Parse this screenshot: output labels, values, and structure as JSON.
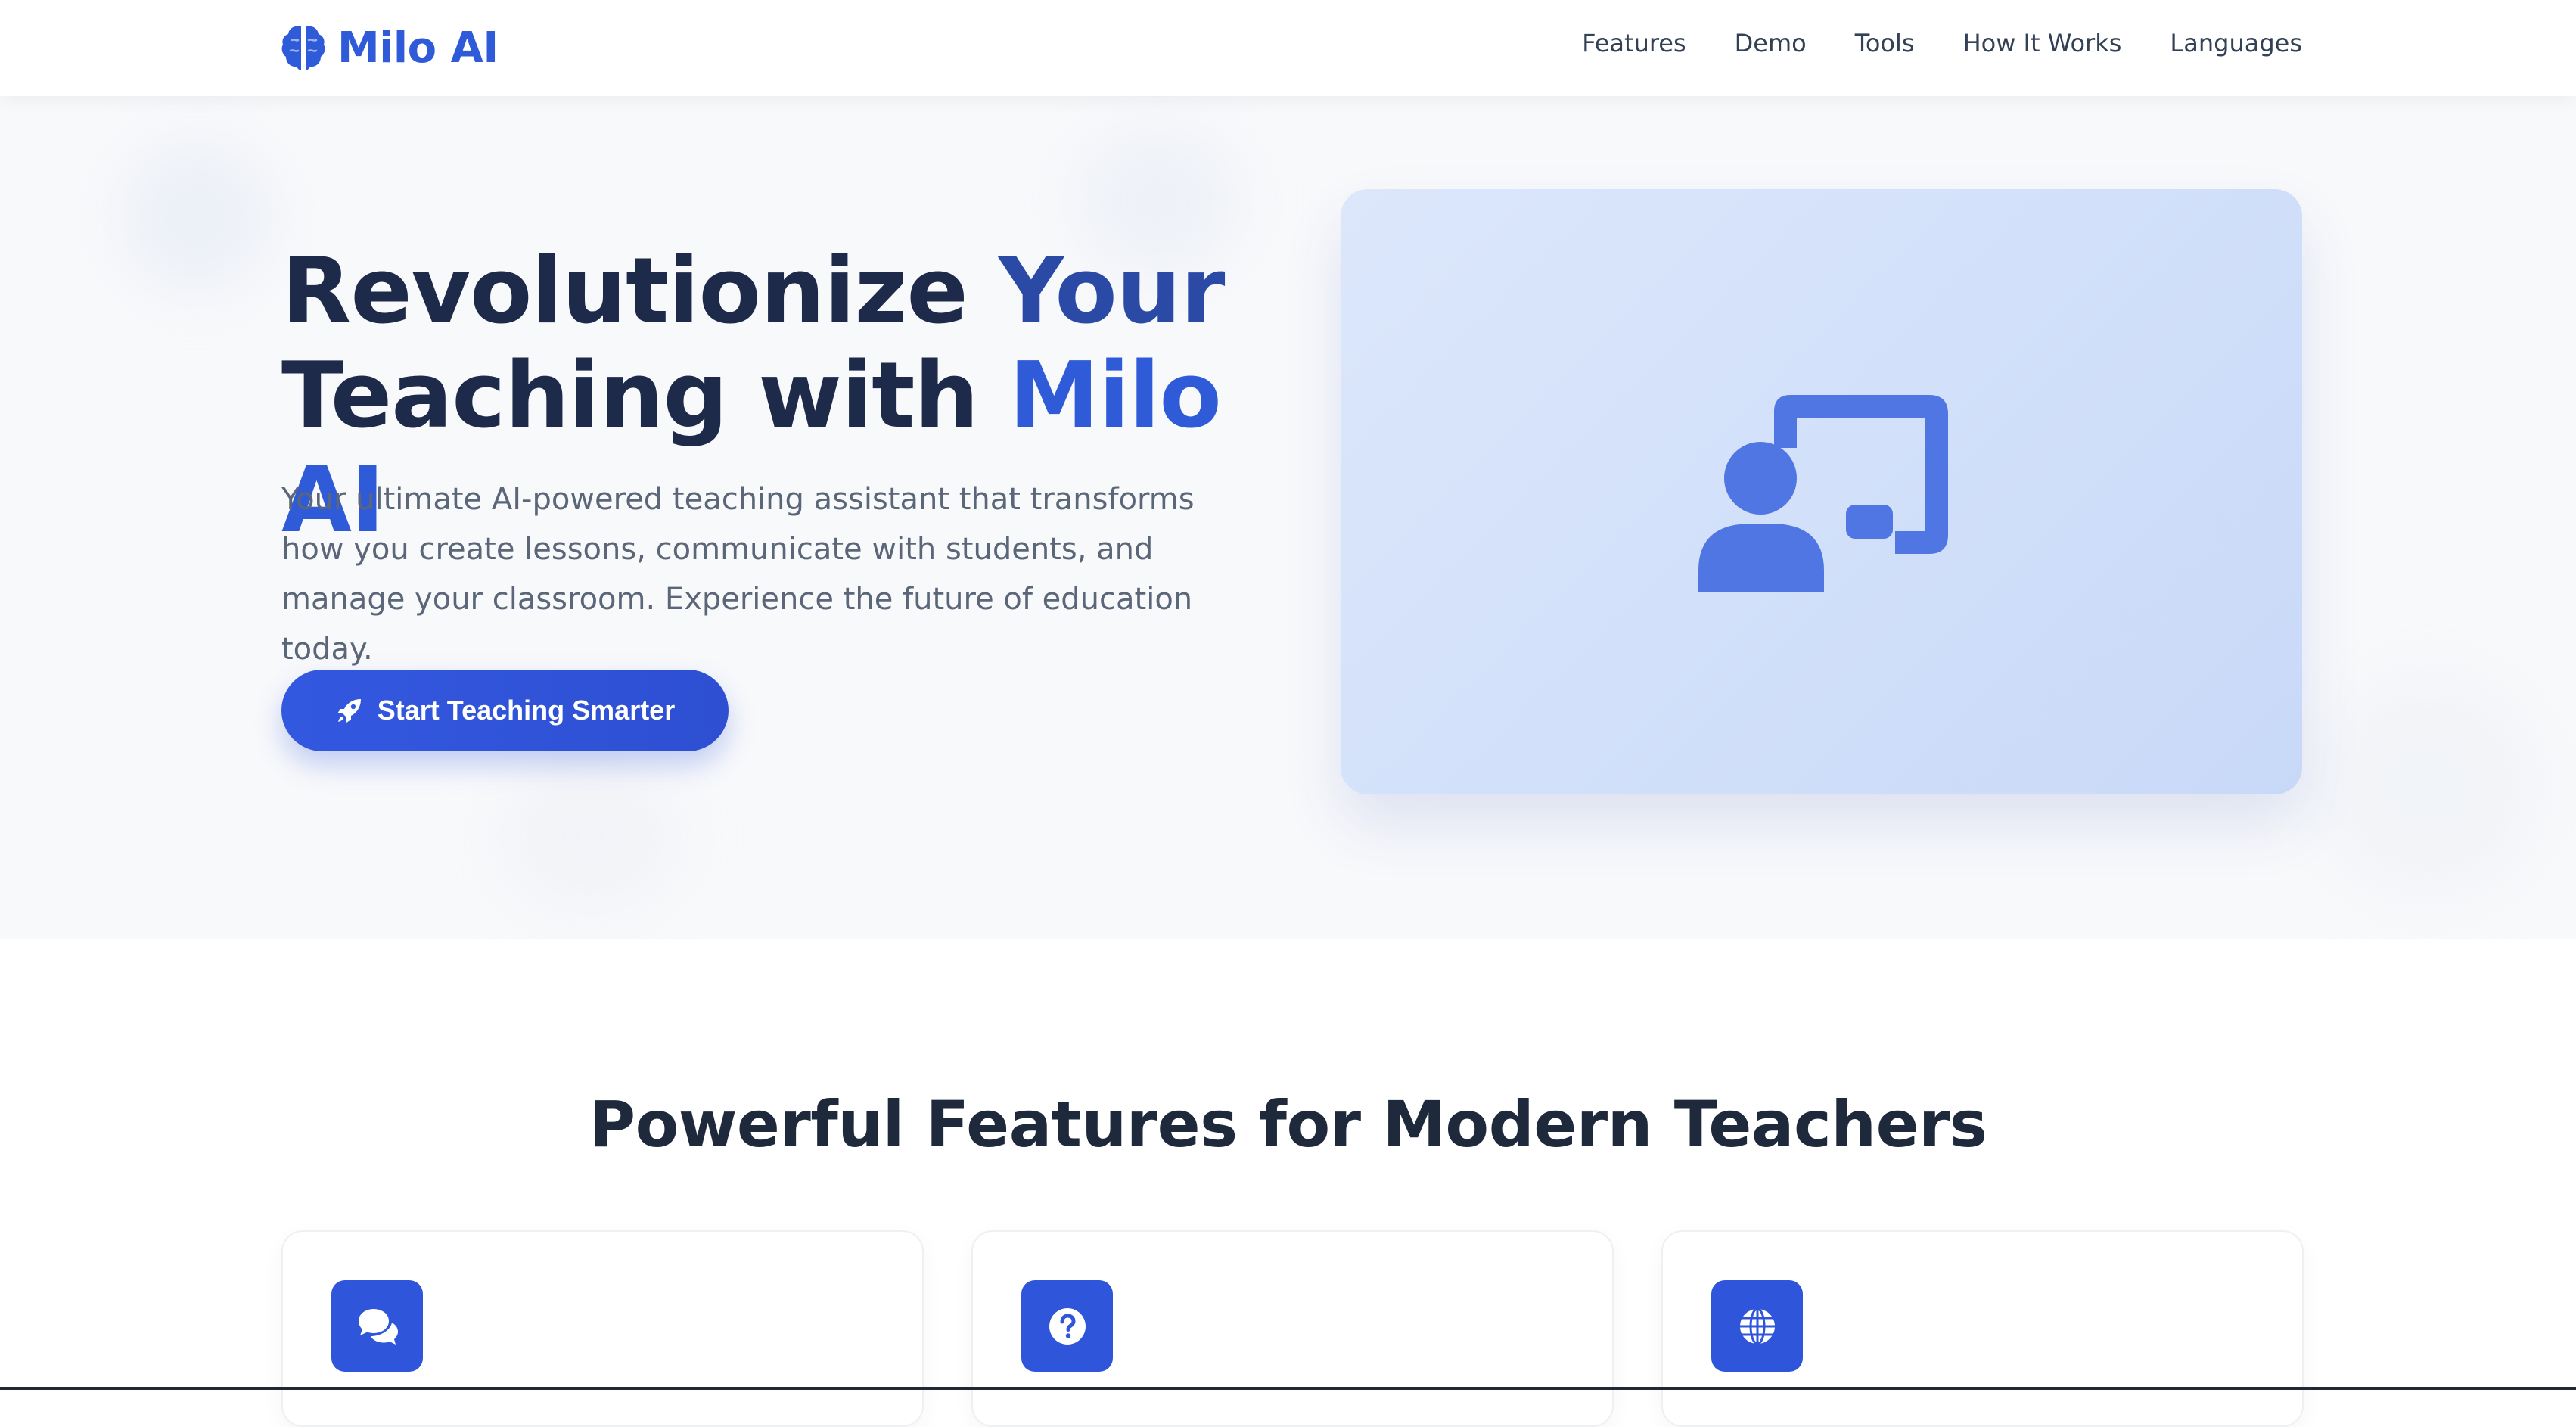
{
  "header": {
    "brand": "Milo AI",
    "brand_icon": "brain-icon",
    "nav": [
      {
        "label": "Features"
      },
      {
        "label": "Demo"
      },
      {
        "label": "Tools"
      },
      {
        "label": "How It Works"
      },
      {
        "label": "Languages"
      }
    ]
  },
  "hero": {
    "title_part1": "Revolutionize ",
    "title_part2": "Your",
    "title_part3": "Teaching with ",
    "title_part4": "Milo AI",
    "description": "Your ultimate AI-powered teaching assistant that transforms how you create lessons, communicate with students, and manage your classroom. Experience the future of education today.",
    "cta_label": "Start Teaching Smarter",
    "cta_icon": "rocket-icon",
    "illustration_icon": "chalkboard-teacher-icon"
  },
  "features": {
    "title": "Powerful Features for Modern Teachers",
    "cards": [
      {
        "icon": "comments-icon"
      },
      {
        "icon": "question-circle-icon"
      },
      {
        "icon": "globe-icon"
      }
    ]
  },
  "colors": {
    "brand_blue": "#2f5bd8",
    "dark_text": "#1e2a4a",
    "muted_text": "#5b6678",
    "hero_bg": "#f8f9fb",
    "card_bg_start": "#dce7fb",
    "card_bg_end": "#c8d9f8",
    "feature_icon_bg": "#2f55db"
  }
}
